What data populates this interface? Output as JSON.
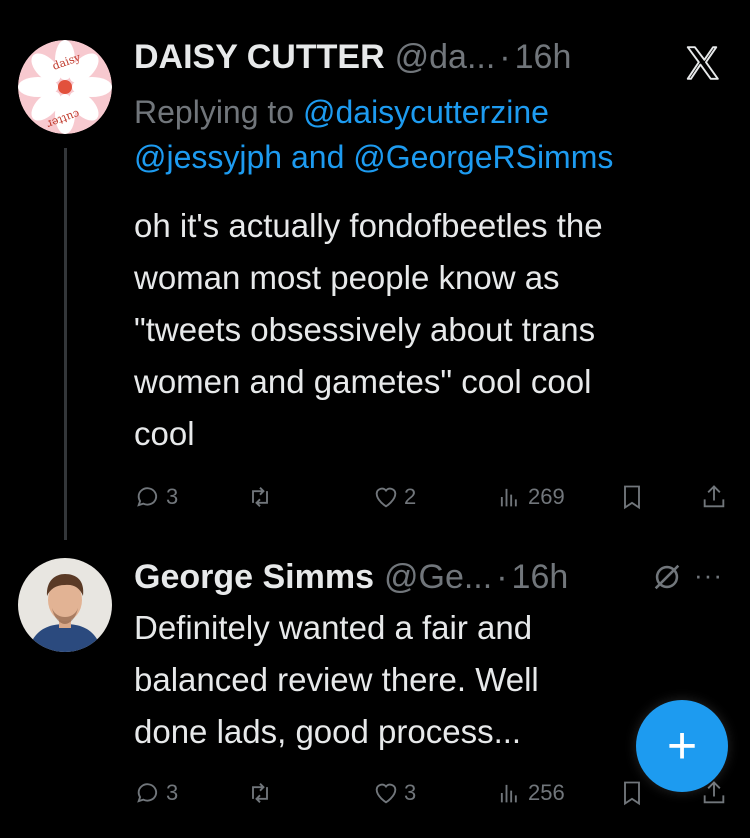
{
  "colors": {
    "background": "#000000",
    "text": "#e7e9ea",
    "muted": "#71767b",
    "accent": "#1d9bf0"
  },
  "tweet1": {
    "avatar_text_top": "daisy",
    "avatar_text_bottom": "cutter",
    "name": "DAISY CUTTER",
    "handle": "@da...",
    "dot": "·",
    "time": "16h",
    "replying_prefix": "Replying to",
    "reply_handle_1": "@daisycutterzine",
    "reply_handle_2": "@jessyjph",
    "reply_and": "and",
    "reply_handle_3": "@GeorgeRSimms",
    "text": "oh it's actually fondofbeetles the\nwoman most people know as\n\"tweets obsessively about trans\nwomen and gametes\" cool cool\ncool",
    "replies": "3",
    "retweets": "",
    "likes": "2",
    "views": "269",
    "corner_icon": "x-logo-icon"
  },
  "tweet2": {
    "name": "George Simms",
    "handle": "@Ge...",
    "dot": "·",
    "time": "16h",
    "more": "···",
    "text": "Definitely wanted a fair and\nbalanced review there. Well\ndone lads, good process...",
    "replies": "3",
    "retweets": "",
    "likes": "3",
    "views": "256"
  },
  "fab": {
    "label": "+"
  }
}
